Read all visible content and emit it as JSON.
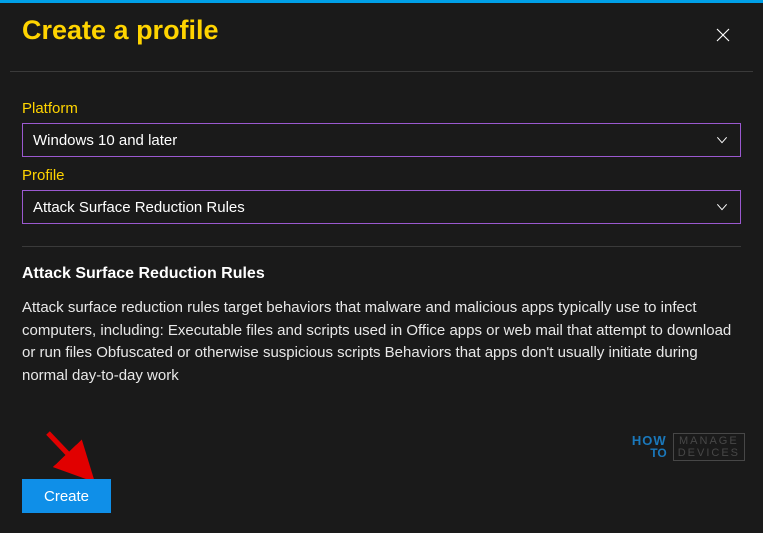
{
  "header": {
    "title": "Create a profile"
  },
  "form": {
    "platform_label": "Platform",
    "platform_value": "Windows 10 and later",
    "profile_label": "Profile",
    "profile_value": "Attack Surface Reduction Rules"
  },
  "section": {
    "title": "Attack Surface Reduction Rules",
    "description": "Attack surface reduction rules target behaviors that malware and malicious apps typically use to infect computers, including: Executable files and scripts used in Office apps or web mail that attempt to download or run files Obfuscated or otherwise suspicious scripts Behaviors that apps don't usually initiate during normal day-to-day work"
  },
  "buttons": {
    "create": "Create"
  },
  "watermark": {
    "how": "HOW",
    "to": "TO",
    "line1": "MANAGE",
    "line2": "DEVICES"
  },
  "colors": {
    "accent": "#ffd400",
    "dropdown_border": "#9b59d0",
    "primary_button": "#0f8fe8",
    "top_border": "#00a0e8"
  }
}
